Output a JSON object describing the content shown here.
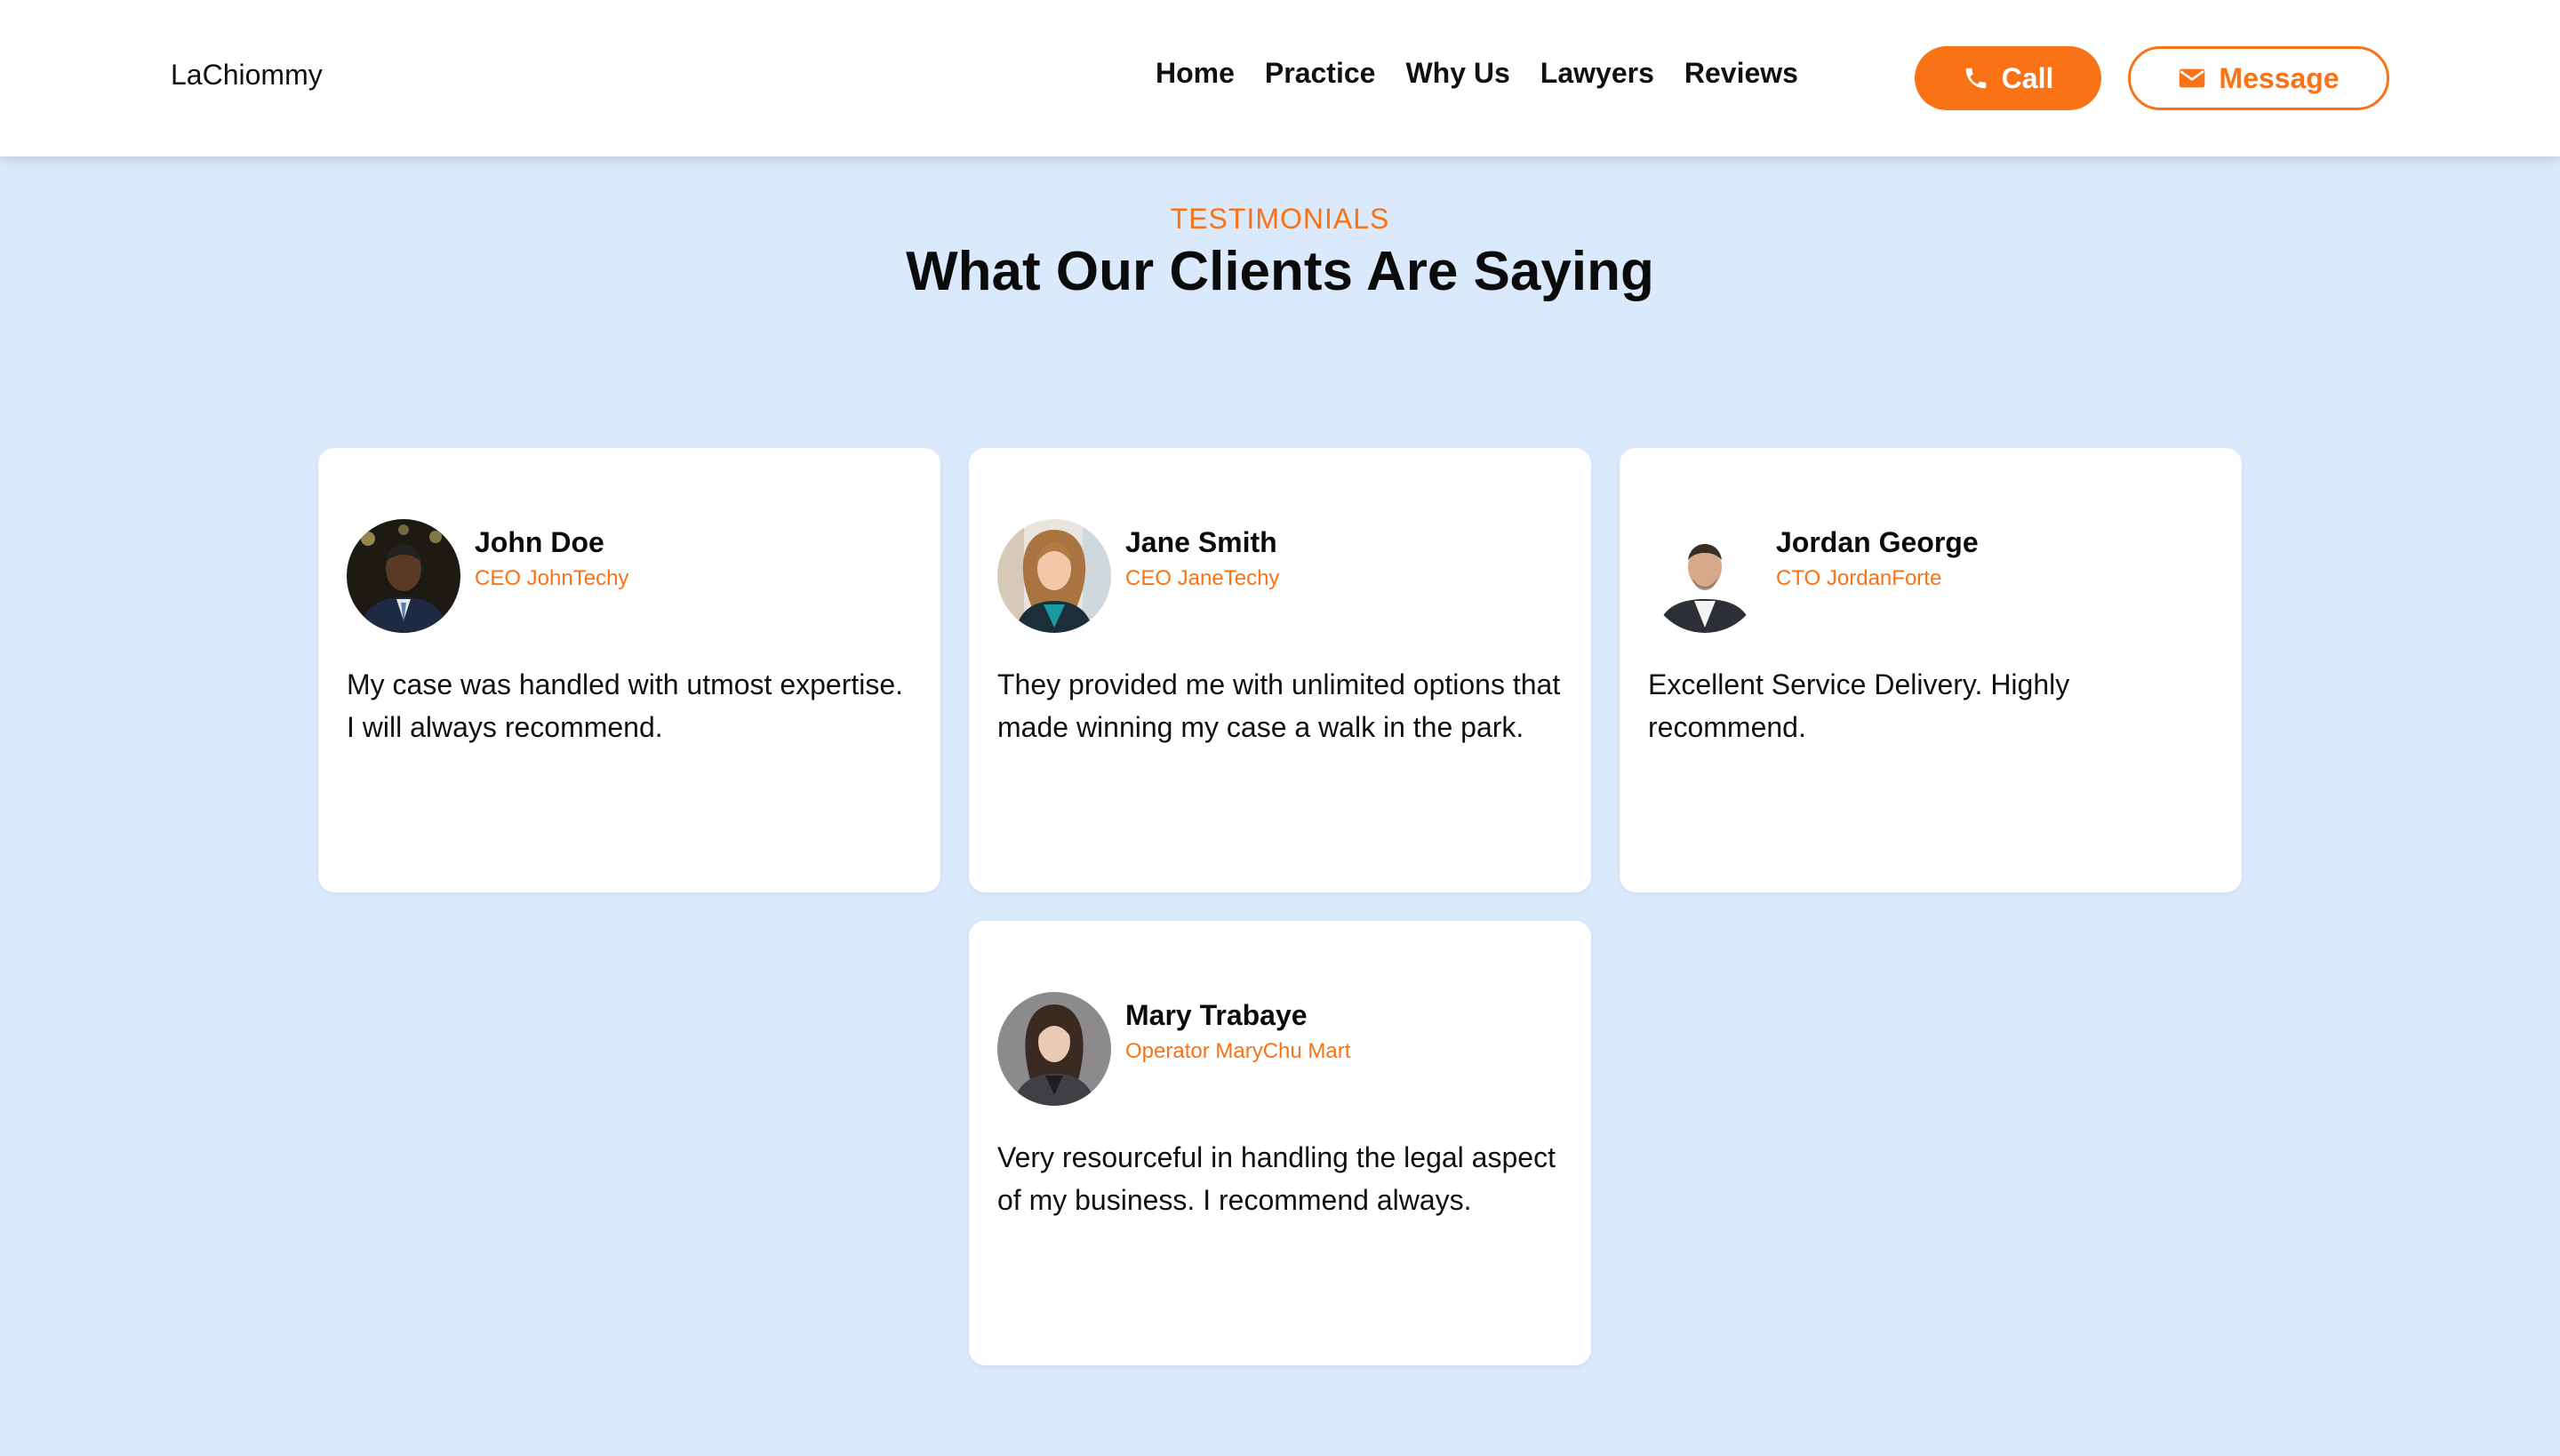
{
  "nav": {
    "brand": "LaChiommy",
    "links": [
      "Home",
      "Practice",
      "Why Us",
      "Lawyers",
      "Reviews"
    ],
    "call_label": "Call",
    "message_label": "Message"
  },
  "section": {
    "eyebrow": "TESTIMONIALS",
    "title": "What Our Clients Are Saying"
  },
  "testimonials": [
    {
      "name": "John Doe",
      "role": "CEO JohnTechy",
      "quote": "My case was handled with utmost expertise. I will always recommend."
    },
    {
      "name": "Jane Smith",
      "role": "CEO JaneTechy",
      "quote": "They provided me with unlimited options that made winning my case a walk in the park."
    },
    {
      "name": "Jordan George",
      "role": "CTO JordanForte",
      "quote": "Excellent Service Delivery. Highly recommend."
    },
    {
      "name": "Mary Trabaye",
      "role": "Operator MaryChu Mart",
      "quote": "Very resourceful in handling the legal aspect of my business. I recommend always."
    }
  ],
  "colors": {
    "accent": "#f97316",
    "background": "#dbe9fc"
  },
  "icons": {
    "call": "phone-icon",
    "message": "envelope-icon"
  }
}
